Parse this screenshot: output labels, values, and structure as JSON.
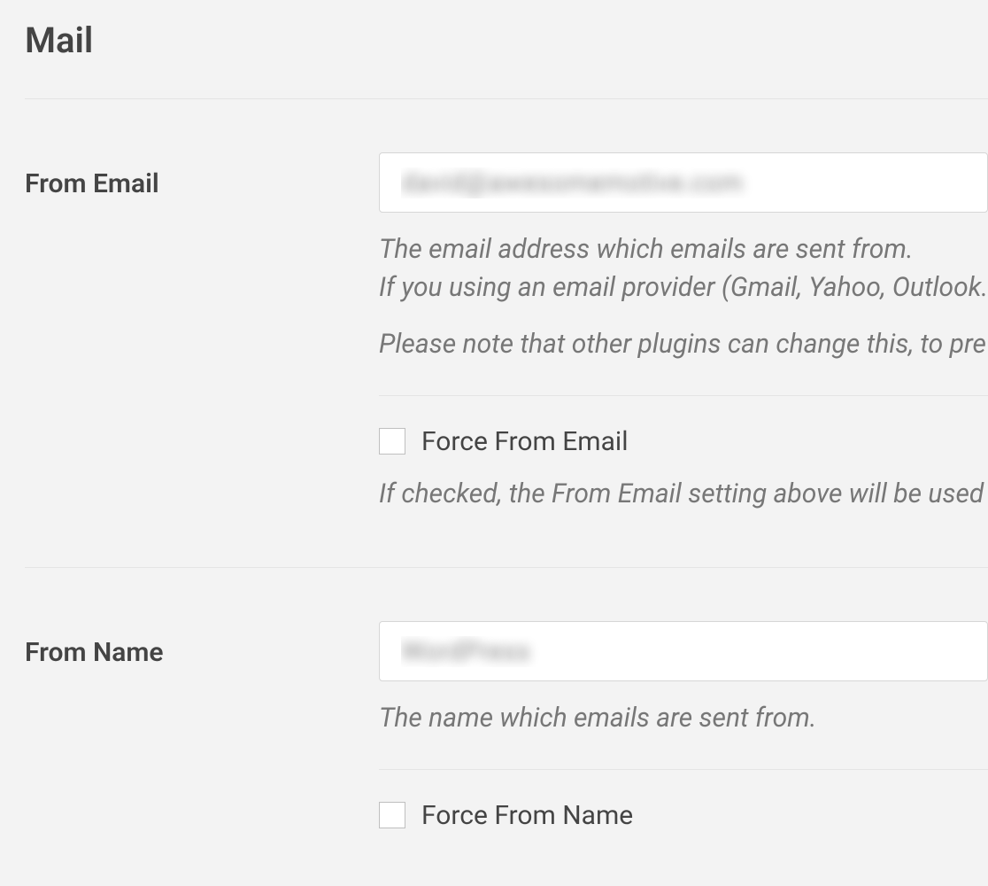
{
  "section_title": "Mail",
  "from_email": {
    "label": "From Email",
    "value": "david@awesomemotive.com",
    "help_line1": "The email address which emails are sent from.",
    "help_line2": "If you using an email provider (Gmail, Yahoo, Outlook.",
    "help_note": "Please note that other plugins can change this, to pre",
    "force_label": "Force From Email",
    "force_help": "If checked, the From Email setting above will be used"
  },
  "from_name": {
    "label": "From Name",
    "value": "WordPress",
    "help_line1": "The name which emails are sent from.",
    "force_label": "Force From Name"
  }
}
